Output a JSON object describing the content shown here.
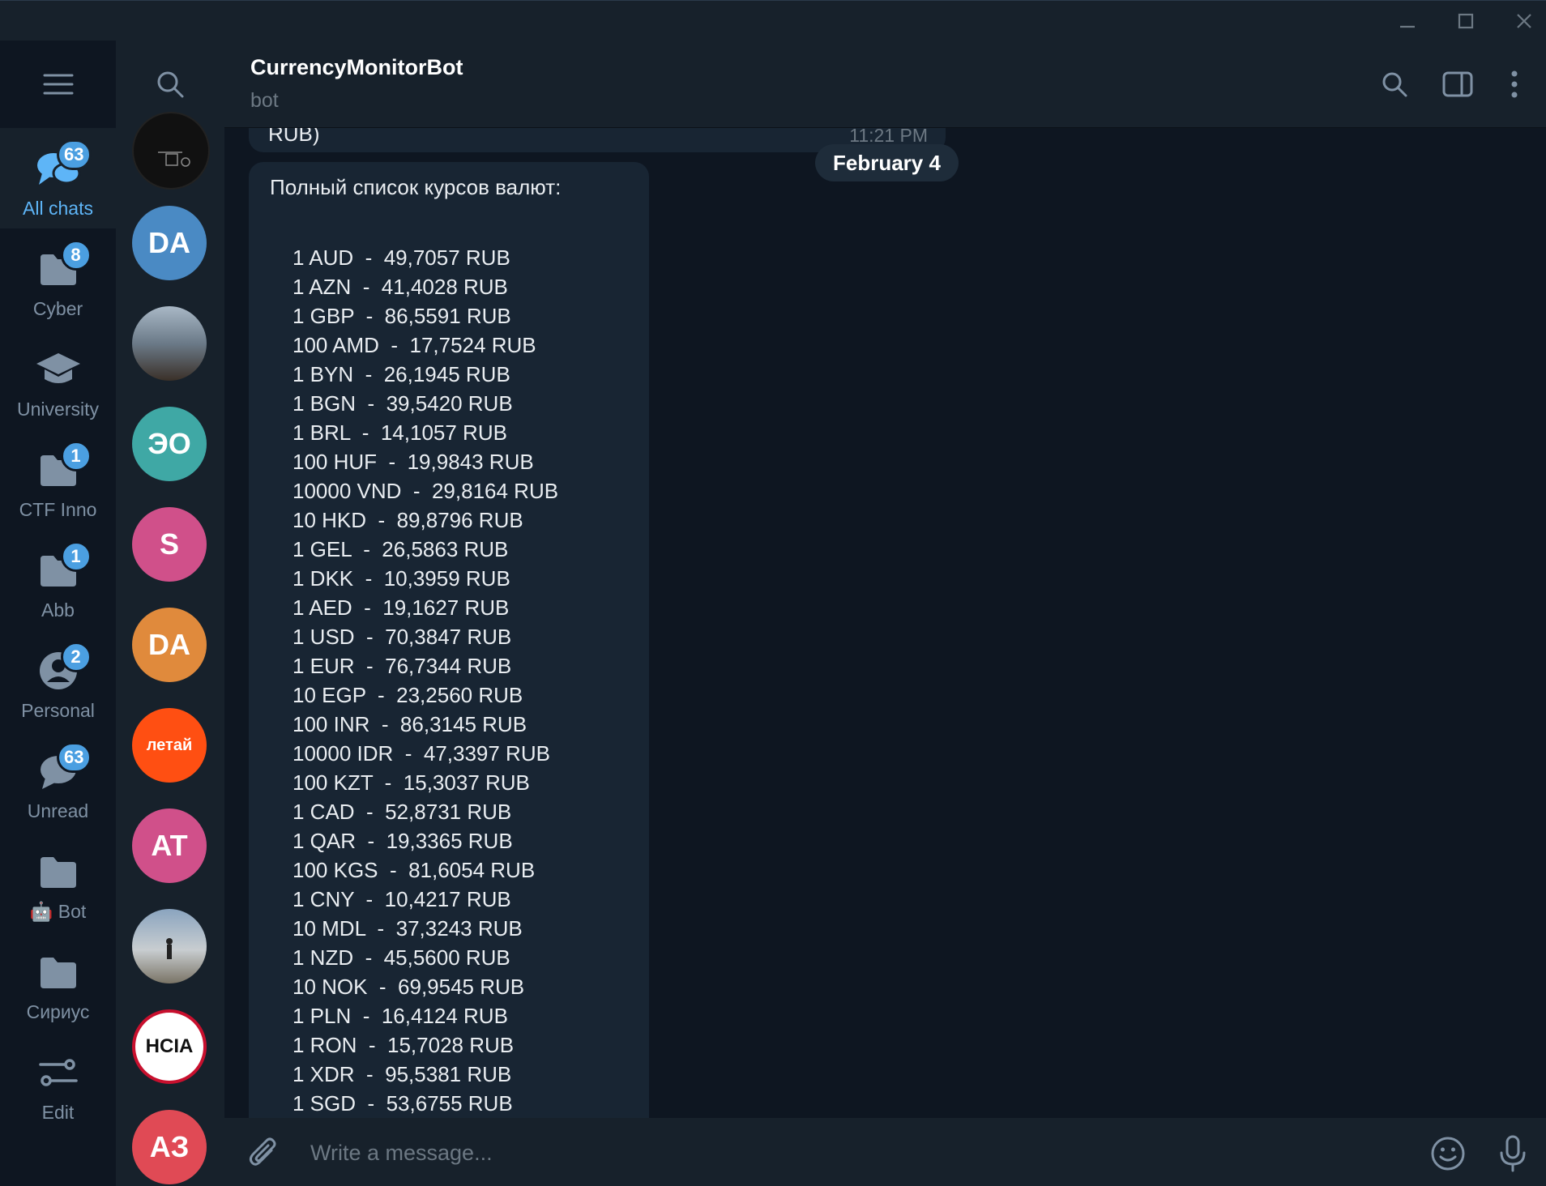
{
  "window": {
    "controls": [
      "minimize-icon",
      "maximize-icon",
      "close-icon"
    ]
  },
  "folders": [
    {
      "label": "All chats",
      "badge": "63",
      "icon": "chat-bubbles-icon",
      "active": true
    },
    {
      "label": "Cyber",
      "badge": "8",
      "icon": "folder-icon"
    },
    {
      "label": "University",
      "badge": "",
      "icon": "graduation-cap-icon"
    },
    {
      "label": "CTF Inno",
      "badge": "1",
      "icon": "folder-icon"
    },
    {
      "label": "Abb",
      "badge": "1",
      "icon": "folder-icon"
    },
    {
      "label": "Personal",
      "badge": "2",
      "icon": "person-icon"
    },
    {
      "label": "Unread",
      "badge": "63",
      "icon": "chat-bubble-icon"
    },
    {
      "label": "🤖 Bot",
      "badge": "",
      "icon": "folder-icon"
    },
    {
      "label": "Сириус",
      "badge": "",
      "icon": "folder-icon"
    },
    {
      "label": "Edit",
      "badge": "",
      "icon": "sliders-icon"
    }
  ],
  "avatars": [
    {
      "initials": "",
      "kind": "image",
      "color": "#111111"
    },
    {
      "initials": "DA",
      "kind": "initials",
      "color": "#4a8ac4"
    },
    {
      "initials": "",
      "kind": "image",
      "color": "#6b7a88"
    },
    {
      "initials": "ЭО",
      "kind": "initials",
      "color": "#3fa8a5"
    },
    {
      "initials": "S",
      "kind": "initials",
      "color": "#d0508a"
    },
    {
      "initials": "DA",
      "kind": "initials",
      "color": "#e08a3c"
    },
    {
      "initials": "летай",
      "kind": "logo",
      "color": "#ff4f12"
    },
    {
      "initials": "AT",
      "kind": "initials",
      "color": "#d0508a"
    },
    {
      "initials": "",
      "kind": "image",
      "color": "#8aa4bf"
    },
    {
      "initials": "HCIA",
      "kind": "logo",
      "color": "#ffffff"
    },
    {
      "initials": "АЗ",
      "kind": "initials",
      "color": "#e04a55"
    }
  ],
  "header": {
    "title": "CurrencyMonitorBot",
    "subtitle": "bot"
  },
  "messages": {
    "prev_tail": "RUB)",
    "prev_time": "11:21 PM",
    "date_pill": "February 4",
    "heading": "Полный список курсов валют:",
    "rates": [
      "1 AUD  -  49,7057 RUB",
      "1 AZN  -  41,4028 RUB",
      "1 GBP  -  86,5591 RUB",
      "100 AMD  -  17,7524 RUB",
      "1 BYN  -  26,1945 RUB",
      "1 BGN  -  39,5420 RUB",
      "1 BRL  -  14,1057 RUB",
      "100 HUF  -  19,9843 RUB",
      "10000 VND  -  29,8164 RUB",
      "10 HKD  -  89,8796 RUB",
      "1 GEL  -  26,5863 RUB",
      "1 DKK  -  10,3959 RUB",
      "1 AED  -  19,1627 RUB",
      "1 USD  -  70,3847 RUB",
      "1 EUR  -  76,7344 RUB",
      "10 EGP  -  23,2560 RUB",
      "100 INR  -  86,3145 RUB",
      "10000 IDR  -  47,3397 RUB",
      "100 KZT  -  15,3037 RUB",
      "1 CAD  -  52,8731 RUB",
      "1 QAR  -  19,3365 RUB",
      "100 KGS  -  81,6054 RUB",
      "1 CNY  -  10,4217 RUB",
      "10 MDL  -  37,3243 RUB",
      "1 NZD  -  45,5600 RUB",
      "10 NOK  -  69,9545 RUB",
      "1 PLN  -  16,4124 RUB",
      "1 RON  -  15,7028 RUB",
      "1 XDR  -  95,5381 RUB",
      "1 SGD  -  53,6755 RUB"
    ]
  },
  "composer": {
    "placeholder": "Write a message..."
  },
  "colors": {
    "accent": "#5eb5f7",
    "badge": "#4b9fe1",
    "panel": "#17212b",
    "background": "#0e1621",
    "bubble": "#182533"
  }
}
